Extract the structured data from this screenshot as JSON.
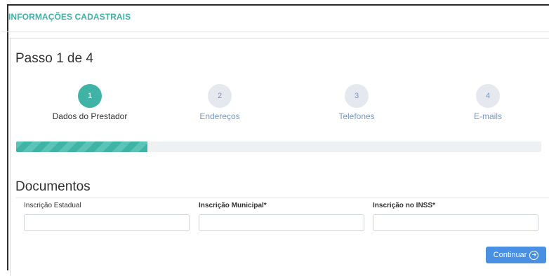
{
  "section": {
    "title": "INFORMAÇÕES CADASTRAIS"
  },
  "wizard": {
    "step_title": "Passo 1 de 4",
    "progress_fraction": 0.25,
    "steps": [
      {
        "number": "1",
        "label": "Dados do Prestador",
        "state": "active"
      },
      {
        "number": "2",
        "label": "Endereços",
        "state": "inactive"
      },
      {
        "number": "3",
        "label": "Telefones",
        "state": "inactive"
      },
      {
        "number": "4",
        "label": "E-mails",
        "state": "inactive"
      }
    ]
  },
  "documents": {
    "title": "Documentos",
    "fields": [
      {
        "label": "Inscrição Estadual",
        "value": "",
        "required": false
      },
      {
        "label": "Inscrição Municipal*",
        "value": "",
        "required": true
      },
      {
        "label": "Inscrição no INSS*",
        "value": "",
        "required": true
      }
    ]
  },
  "actions": {
    "continue_label": "Continuar",
    "continue_icon": "arrow-right-circle-icon"
  },
  "colors": {
    "accent": "#3fb3a6",
    "inactive_text": "#7a97c6",
    "button": "#4a90e2"
  }
}
